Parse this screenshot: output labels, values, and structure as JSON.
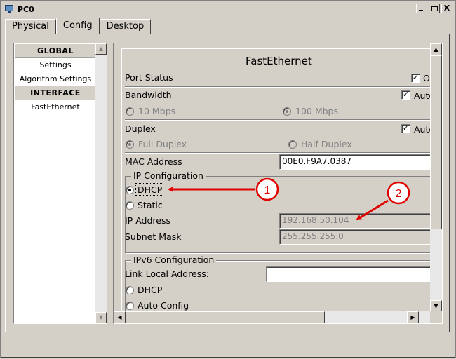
{
  "window": {
    "title": "PC0"
  },
  "window_buttons": {
    "minimize": "_",
    "maximize": "□",
    "close": "X"
  },
  "tabs": [
    {
      "label": "Physical"
    },
    {
      "label": "Config",
      "active": true
    },
    {
      "label": "Desktop"
    }
  ],
  "nav": {
    "items": [
      {
        "label": "GLOBAL",
        "type": "header"
      },
      {
        "label": "Settings"
      },
      {
        "label": "Algorithm Settings"
      },
      {
        "label": "INTERFACE",
        "type": "header"
      },
      {
        "label": "FastEthernet"
      }
    ]
  },
  "config": {
    "title": "FastEthernet",
    "port_status": {
      "label": "Port Status",
      "checked": true,
      "checkbox_text": "On"
    },
    "bandwidth": {
      "label": "Bandwidth",
      "auto_checked": true,
      "auto_text": "Auto",
      "opt_10": "10 Mbps",
      "opt_100": "100 Mbps",
      "selected": "100 Mbps"
    },
    "duplex": {
      "label": "Duplex",
      "auto_checked": true,
      "auto_text": "Auto",
      "full": "Full Duplex",
      "half": "Half Duplex",
      "selected": "Full Duplex"
    },
    "mac": {
      "label": "MAC Address",
      "value": "00E0.F9A7.0387"
    },
    "ipv4": {
      "legend": "IP Configuration",
      "dhcp": "DHCP",
      "static": "Static",
      "selected": "DHCP",
      "ip_label": "IP Address",
      "ip_value": "192.168.50.104",
      "mask_label": "Subnet Mask",
      "mask_value": "255.255.255.0"
    },
    "ipv6": {
      "legend": "IPv6 Configuration",
      "link_local_label": "Link Local Address:",
      "link_local_value": "",
      "dhcp": "DHCP",
      "auto": "Auto Config"
    }
  },
  "annotations": [
    {
      "number": "1"
    },
    {
      "number": "2"
    }
  ],
  "colors": {
    "annotation": "#e00000",
    "window_bg": "#d4d0c8"
  }
}
